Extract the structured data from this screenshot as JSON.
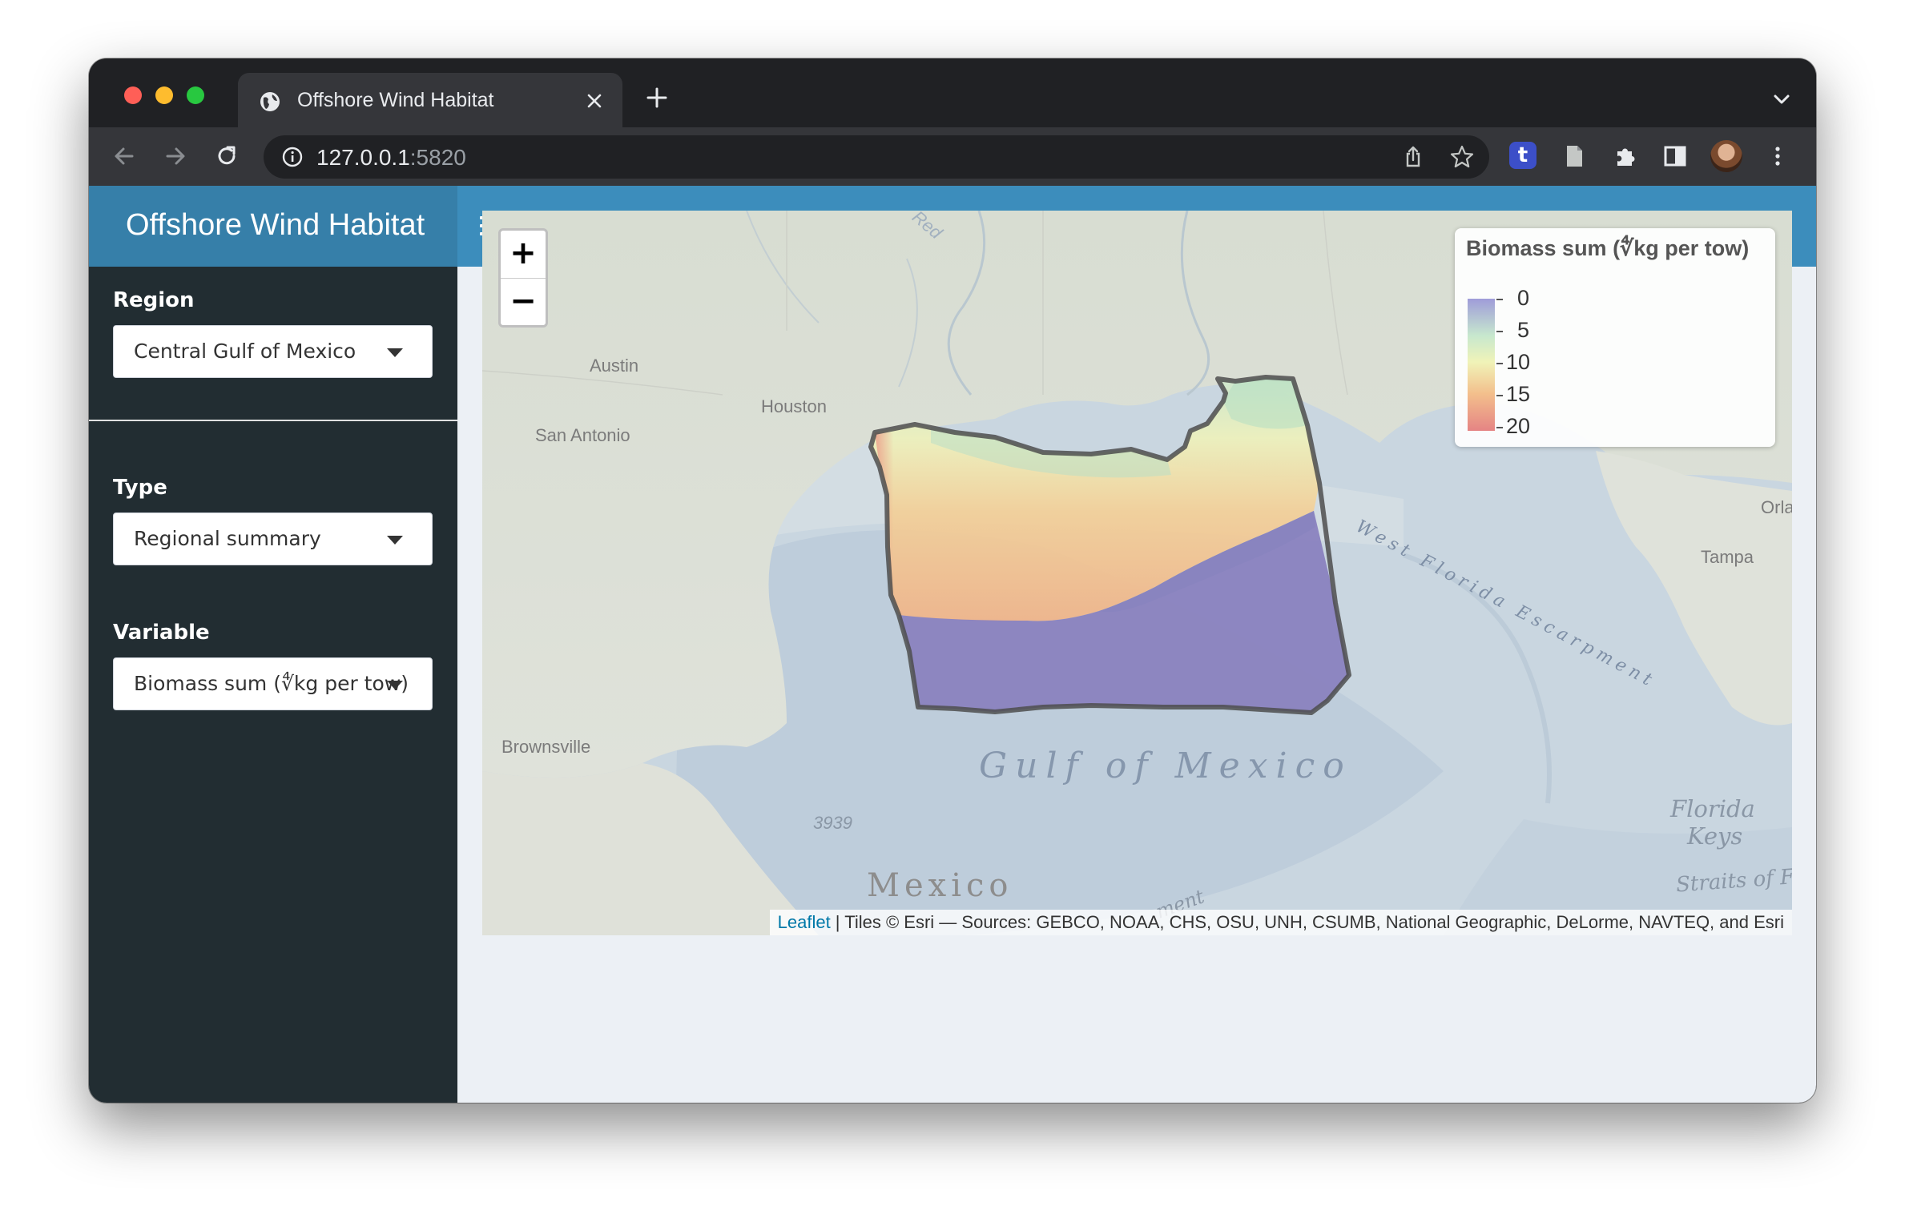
{
  "browser": {
    "tab_title": "Offshore Wind Habitat",
    "url_host": "127.0.0.1",
    "url_port": ":5820",
    "extension_badge": "t"
  },
  "app": {
    "title": "Offshore Wind Habitat",
    "header_color": "#3c8dbc",
    "sidebar_color": "#222d32"
  },
  "sidebar": {
    "region_label": "Region",
    "region_value": "Central Gulf of Mexico",
    "type_label": "Type",
    "type_value": "Regional summary",
    "variable_label": "Variable",
    "variable_value": "Biomass sum (∜kg per tow)"
  },
  "map": {
    "zoom_in": "+",
    "zoom_out": "−",
    "place_labels": [
      "Austin",
      "Houston",
      "San Antonio",
      "Brownsville",
      "Tampa",
      "Orlar",
      "Florida",
      "Keys",
      "Mexico",
      "Gulf of Mexico",
      "West Florida Escarpment",
      "3939",
      "Red",
      "Straits of Fl",
      "ment"
    ],
    "legend": {
      "title": "Biomass sum (∜kg per tow)",
      "ticks": [
        "0",
        "5",
        "10",
        "15",
        "20"
      ],
      "colors": [
        "#9f9cd9",
        "#c7e8ce",
        "#f0f3b8",
        "#f3bf8c",
        "#e58484"
      ]
    },
    "attribution_link": "Leaflet",
    "attribution_text": " | Tiles © Esri — Sources: GEBCO, NOAA, CHS, OSU, UNH, CSUMB, National Geographic, DeLorme, NAVTEQ, and Esri"
  }
}
